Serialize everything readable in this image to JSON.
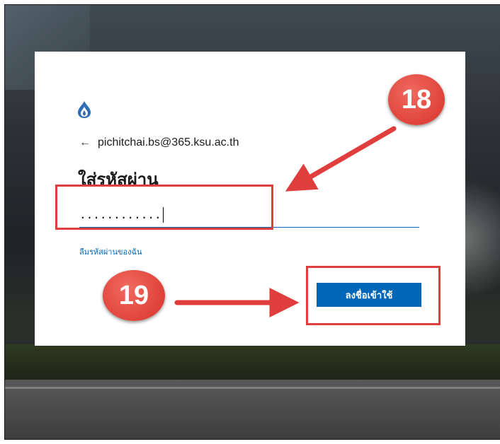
{
  "login": {
    "account_email": "pichitchai.bs@365.ksu.ac.th",
    "back_arrow": "←",
    "heading": "ใส่รหัสผ่าน",
    "password_masked": "............",
    "forgot_link": "ลืมรหัสผ่านของฉัน",
    "sign_in_button": "ลงชื่อเข้าใช้"
  },
  "annotations": {
    "step_18": "18",
    "step_19": "19",
    "color": "#e03d3d"
  },
  "icons": {
    "logo": "university-flame-logo-icon",
    "back": "back-arrow-icon"
  },
  "colors": {
    "accent": "#0067b8"
  }
}
